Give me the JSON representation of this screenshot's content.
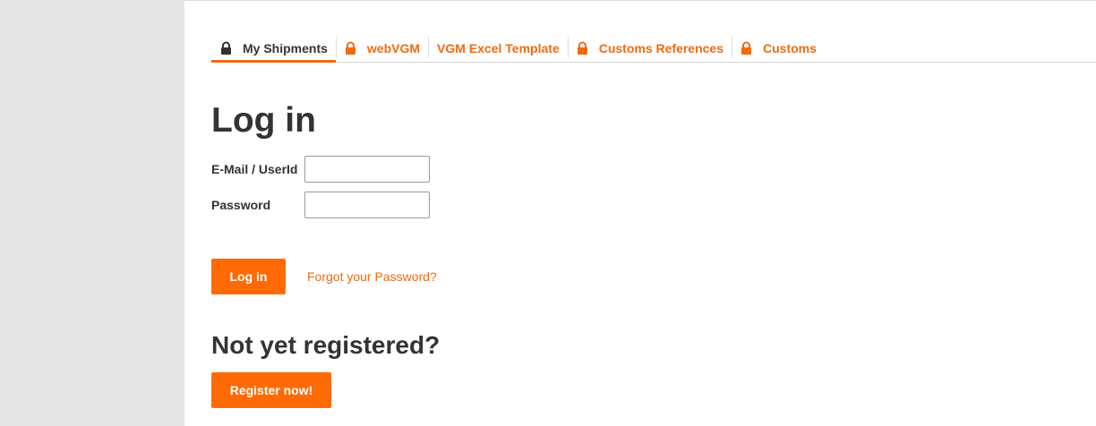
{
  "tabs": [
    {
      "label": "My Shipments",
      "icon": "lock-icon",
      "active": true
    },
    {
      "label": "webVGM",
      "icon": "lock-icon",
      "active": false
    },
    {
      "label": "VGM Excel Template",
      "icon": null,
      "active": false
    },
    {
      "label": "Customs References",
      "icon": "lock-icon",
      "active": false
    },
    {
      "label": "Customs",
      "icon": "lock-icon",
      "active": false
    }
  ],
  "login": {
    "title": "Log in",
    "email_label": "E-Mail / UserId",
    "email_value": "",
    "password_label": "Password",
    "password_value": "",
    "submit_label": "Log in",
    "forgot_label": "Forgot your Password?"
  },
  "register": {
    "title": "Not yet registered?",
    "button_label": "Register now!"
  },
  "colors": {
    "accent": "#ff6a05",
    "link": "#f26a10",
    "text": "#333333",
    "gutter": "#e6e6e6"
  }
}
